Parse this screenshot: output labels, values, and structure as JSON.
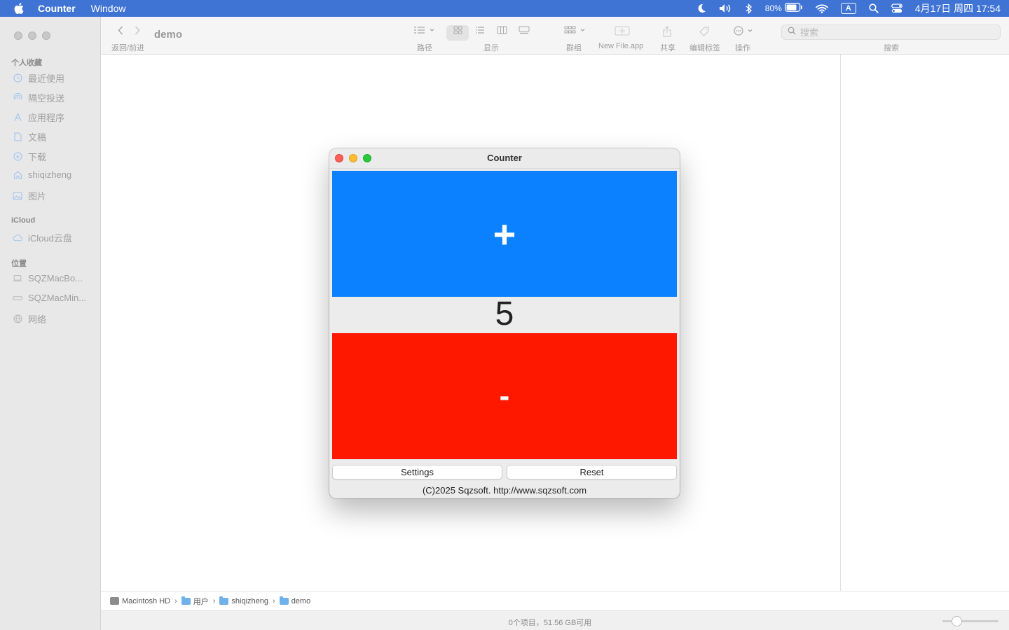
{
  "menubar": {
    "app_name": "Counter",
    "menus": [
      "Window"
    ],
    "battery_percent": "80%",
    "input_method": "A",
    "clock": "4月17日 周四  17:54"
  },
  "finder": {
    "title": "demo",
    "toolbar": {
      "nav_label": "返回/前进",
      "path_label": "路径",
      "view_label": "显示",
      "group_label": "群组",
      "newfile_label": "New File.app",
      "share_label": "共享",
      "tags_label": "编辑标签",
      "action_label": "操作",
      "search_label": "搜索",
      "search_placeholder": "搜索"
    },
    "sidebar": {
      "favorites_heading": "个人收藏",
      "favorites": [
        {
          "label": "最近使用",
          "icon": "clock-icon"
        },
        {
          "label": "隔空投送",
          "icon": "airdrop-icon"
        },
        {
          "label": "应用程序",
          "icon": "apps-icon"
        },
        {
          "label": "文稿",
          "icon": "document-icon"
        },
        {
          "label": "下载",
          "icon": "download-icon"
        },
        {
          "label": "shiqizheng",
          "icon": "home-icon"
        },
        {
          "label": "图片",
          "icon": "photo-icon"
        }
      ],
      "icloud_heading": "iCloud",
      "icloud": [
        {
          "label": "iCloud云盘",
          "icon": "cloud-icon"
        }
      ],
      "locations_heading": "位置",
      "locations": [
        {
          "label": "SQZMacBo...",
          "icon": "laptop-icon"
        },
        {
          "label": "SQZMacMin...",
          "icon": "mini-icon"
        },
        {
          "label": "网络",
          "icon": "network-icon"
        }
      ]
    },
    "path": [
      "Macintosh HD",
      "用户",
      "shiqizheng",
      "demo"
    ],
    "status": "0个项目，51.56 GB可用"
  },
  "counter": {
    "title": "Counter",
    "plus_label": "+",
    "count": "5",
    "minus_label": "-",
    "settings_label": "Settings",
    "reset_label": "Reset",
    "copyright": "(C)2025 Sqzsoft. http://www.sqzsoft.com",
    "colors": {
      "plus": "#0b81ff",
      "minus": "#ff1800"
    }
  }
}
